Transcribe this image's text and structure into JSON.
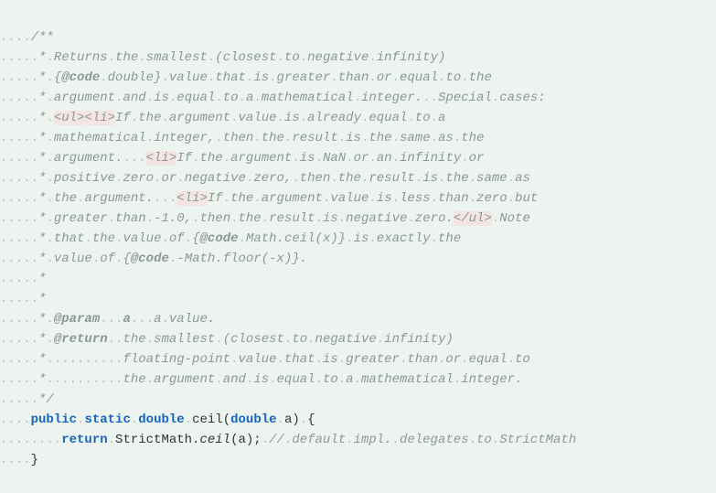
{
  "indent4": "....",
  "indent5": ".....",
  "indent6": "......",
  "indent8": "........",
  "dot": ".",
  "comment_open": "/**",
  "star": "*",
  "doc_line1_a": "Returns",
  "doc_line1_b": "the",
  "doc_line1_c": "smallest",
  "doc_line1_d": "(closest",
  "doc_line1_e": "to",
  "doc_line1_f": "negative",
  "doc_line1_g": "infinity)",
  "brace_open": "{",
  "brace_close": "}",
  "at_code": "@code",
  "doc_line2_a": "double",
  "doc_line2_b": "value",
  "doc_line2_c": "that",
  "doc_line2_d": "is",
  "doc_line2_e": "greater",
  "doc_line2_f": "than",
  "doc_line2_g": "or",
  "doc_line2_h": "equal",
  "doc_line2_i": "to",
  "doc_line2_j": "the",
  "doc_line3_a": "argument",
  "doc_line3_b": "and",
  "doc_line3_c": "is",
  "doc_line3_d": "equal",
  "doc_line3_e": "to",
  "doc_line3_f": "a",
  "doc_line3_g": "mathematical",
  "doc_line3_h": "integer.",
  "doc_line3_i": "Special",
  "doc_line3_j": "cases:",
  "tag_ul": "<ul>",
  "tag_li": "<li>",
  "tag_ul_close": "</ul>",
  "doc_line4_a": "If",
  "doc_line4_b": "the",
  "doc_line4_c": "argument",
  "doc_line4_d": "value",
  "doc_line4_e": "is",
  "doc_line4_f": "already",
  "doc_line4_g": "equal",
  "doc_line4_h": "to",
  "doc_line4_i": "a",
  "doc_line5_a": "mathematical",
  "doc_line5_b": "integer,",
  "doc_line5_c": "then",
  "doc_line5_d": "the",
  "doc_line5_e": "result",
  "doc_line5_f": "is",
  "doc_line5_g": "the",
  "doc_line5_h": "same",
  "doc_line5_i": "as",
  "doc_line5_j": "the",
  "doc_line6_a": "argument.",
  "doc_line6_b": "If",
  "doc_line6_c": "the",
  "doc_line6_d": "argument",
  "doc_line6_e": "is",
  "doc_line6_f": "NaN",
  "doc_line6_g": "or",
  "doc_line6_h": "an",
  "doc_line6_i": "infinity",
  "doc_line6_j": "or",
  "doc_line7_a": "positive",
  "doc_line7_b": "zero",
  "doc_line7_c": "or",
  "doc_line7_d": "negative",
  "doc_line7_e": "zero,",
  "doc_line7_f": "then",
  "doc_line7_g": "the",
  "doc_line7_h": "result",
  "doc_line7_i": "is",
  "doc_line7_j": "the",
  "doc_line7_k": "same",
  "doc_line7_l": "as",
  "doc_line8_a": "the",
  "doc_line8_b": "argument.",
  "doc_line8_c": "If",
  "doc_line8_d": "the",
  "doc_line8_e": "argument",
  "doc_line8_f": "value",
  "doc_line8_g": "is",
  "doc_line8_h": "less",
  "doc_line8_i": "than",
  "doc_line8_j": "zero",
  "doc_line8_k": "but",
  "doc_line9_a": "greater",
  "doc_line9_b": "than",
  "doc_line9_c": "-1.0,",
  "doc_line9_d": "then",
  "doc_line9_e": "the",
  "doc_line9_f": "result",
  "doc_line9_g": "is",
  "doc_line9_h": "negative",
  "doc_line9_i": "zero.",
  "doc_line9_j": "Note",
  "doc_line10_a": "that",
  "doc_line10_b": "the",
  "doc_line10_c": "value",
  "doc_line10_d": "of",
  "doc_line10_e": "Math.ceil(x)",
  "doc_line10_f": "is",
  "doc_line10_g": "exactly",
  "doc_line10_h": "the",
  "doc_line11_a": "value",
  "doc_line11_b": "of",
  "doc_line11_c": "-Math.floor(-x)",
  "doc_line11_d": ".",
  "at_param": "@param",
  "param_name": "a",
  "param_desc_a": "a",
  "param_desc_b": "value.",
  "at_return": "@return",
  "ret_l1_a": "the",
  "ret_l1_b": "smallest",
  "ret_l1_c": "(closest",
  "ret_l1_d": "to",
  "ret_l1_e": "negative",
  "ret_l1_f": "infinity)",
  "ret_l2_a": "floating-point",
  "ret_l2_b": "value",
  "ret_l2_c": "that",
  "ret_l2_d": "is",
  "ret_l2_e": "greater",
  "ret_l2_f": "than",
  "ret_l2_g": "or",
  "ret_l2_h": "equal",
  "ret_l2_i": "to",
  "ret_l3_a": "the",
  "ret_l3_b": "argument",
  "ret_l3_c": "and",
  "ret_l3_d": "is",
  "ret_l3_e": "equal",
  "ret_l3_f": "to",
  "ret_l3_g": "a",
  "ret_l3_h": "mathematical",
  "ret_l3_i": "integer.",
  "comment_close": "*/",
  "kw_public": "public",
  "kw_static": "static",
  "kw_double": "double",
  "fn_name": "ceil(",
  "fn_param": "a)",
  "kw_return": "return",
  "call": "StrictMath.",
  "call_ceil": "ceil",
  "call_tail": "(a);",
  "inline_comment_a": "//",
  "inline_comment_b": "default",
  "inline_comment_c": "impl.",
  "inline_comment_d": "delegates",
  "inline_comment_e": "to",
  "inline_comment_f": "StrictMath",
  "cbrace_close": "}",
  "ws3": "...",
  "ws2": "..",
  "ws10": ".........."
}
